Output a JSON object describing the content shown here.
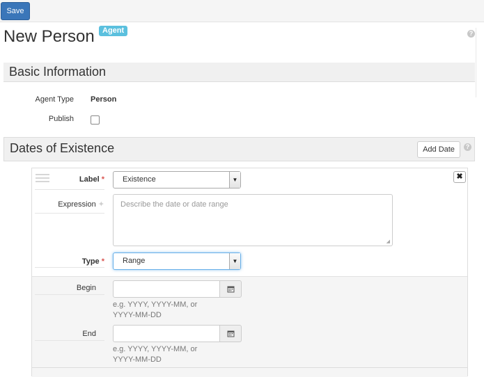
{
  "toolbar": {
    "save_label": "Save"
  },
  "header": {
    "title": "New Person",
    "badge": "Agent",
    "help_glyph": "?"
  },
  "basic_info": {
    "heading": "Basic Information",
    "agent_type_label": "Agent Type",
    "agent_type_value": "Person",
    "publish_label": "Publish",
    "publish_checked": false
  },
  "dates": {
    "heading": "Dates of Existence",
    "add_date_label": "Add Date",
    "help_glyph": "?",
    "remove_glyph": "✖",
    "label_field": {
      "label": "Label",
      "required_mark": "*",
      "value": "Existence"
    },
    "expression_field": {
      "label": "Expression",
      "optional_mark": "✦",
      "placeholder": "Describe the date or date range"
    },
    "type_field": {
      "label": "Type",
      "required_mark": "*",
      "value": "Range"
    },
    "begin_field": {
      "label": "Begin",
      "value": "",
      "hint_line1": "e.g. YYYY, YYYY-MM, or",
      "hint_line2": "YYYY-MM-DD"
    },
    "end_field": {
      "label": "End",
      "value": "",
      "hint_line1": "e.g. YYYY, YYYY-MM, or",
      "hint_line2": "YYYY-MM-DD"
    }
  },
  "icons": {
    "calendar": "calendar-icon",
    "select_arrow": "caret-down-icon",
    "drag": "drag-handle-icon",
    "remove": "close-icon",
    "help": "help-icon"
  },
  "colors": {
    "primary": "#3a76b9",
    "badge": "#5bc0de",
    "required": "#d9534f",
    "focus": "#66afe9"
  }
}
